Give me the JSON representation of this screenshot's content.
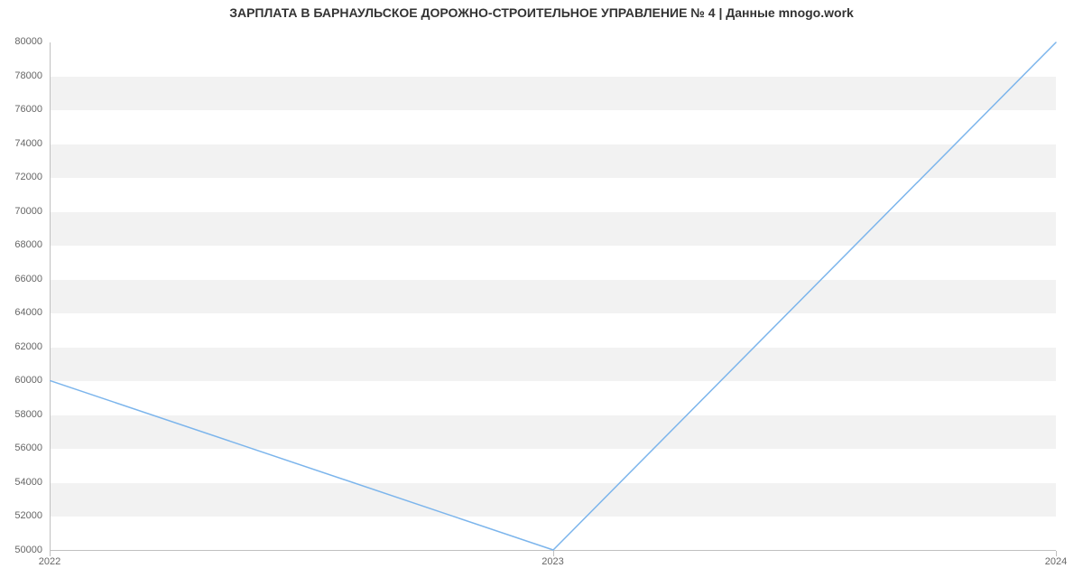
{
  "chart_data": {
    "type": "line",
    "title": "ЗАРПЛАТА В  БАРНАУЛЬСКОЕ ДОРОЖНО-СТРОИТЕЛЬНОЕ УПРАВЛЕНИЕ № 4 | Данные mnogo.work",
    "categories": [
      "2022",
      "2023",
      "2024"
    ],
    "values": [
      60000,
      50000,
      80000
    ],
    "y_ticks": [
      50000,
      52000,
      54000,
      56000,
      58000,
      60000,
      62000,
      64000,
      66000,
      68000,
      70000,
      72000,
      74000,
      76000,
      78000,
      80000
    ],
    "ylim": [
      50000,
      80000
    ],
    "xlabel": "",
    "ylabel": "",
    "line_color": "#7cb5ec"
  }
}
